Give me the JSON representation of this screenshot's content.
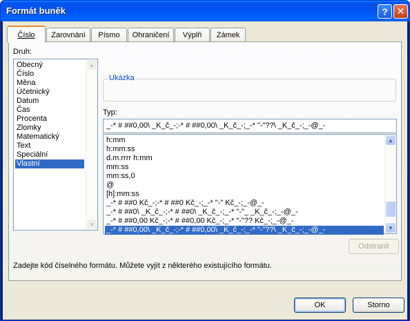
{
  "window": {
    "title": "Formát buněk"
  },
  "titlebar": {
    "help_glyph": "?",
    "close_glyph": "✕"
  },
  "tabs": [
    {
      "label": "Číslo"
    },
    {
      "label": "Zarovnání"
    },
    {
      "label": "Písmo"
    },
    {
      "label": "Ohraničení"
    },
    {
      "label": "Výplň"
    },
    {
      "label": "Zámek"
    }
  ],
  "category": {
    "label": "Druh:",
    "items": [
      "Obecný",
      "Číslo",
      "Měna",
      "Účetnický",
      "Datum",
      "Čas",
      "Procenta",
      "Zlomky",
      "Matematický",
      "Text",
      "Speciální",
      "Vlastní"
    ],
    "selected": "Vlastní"
  },
  "sample": {
    "legend": "Ukázka",
    "value": ""
  },
  "type": {
    "label": "Typ:",
    "value": "_-* # ##0,00\\ _K_č_-;-* # ##0,00\\ _K_č_-;_-* \"-\"??\\ _K_č_-;_-@_-",
    "items": [
      "h:mm",
      "h:mm:ss",
      "d.m.rrrr h:mm",
      "mm:ss",
      "mm:ss,0",
      "@",
      "[h]:mm:ss",
      "_-* # ##0 Kč_-;-* # ##0 Kč_-;_-* \"-\" Kč_-;_-@_-",
      "_-* # ##0\\ _K_č_-;-* # ##0\\ _K_č_-;_-* \"-\"_ _K_č_-;_-@_-",
      "_-* # ##0,00 Kč_-;-* # ##0,00 Kč_-;_-* \"-\"?? Kč_-;_-@_-",
      "_-* # ##0,00\\ _K_č_-;-* # ##0,00\\ _K_č_-;_-* \"-\"??\\ _K_č_-;_-@_-"
    ],
    "selected_index": 10
  },
  "buttons": {
    "delete": "Odstranit",
    "ok": "OK",
    "cancel": "Storno"
  },
  "help_text": "Zadejte kód číselného formátu. Můžete vyjít z některého existujícího formátu."
}
